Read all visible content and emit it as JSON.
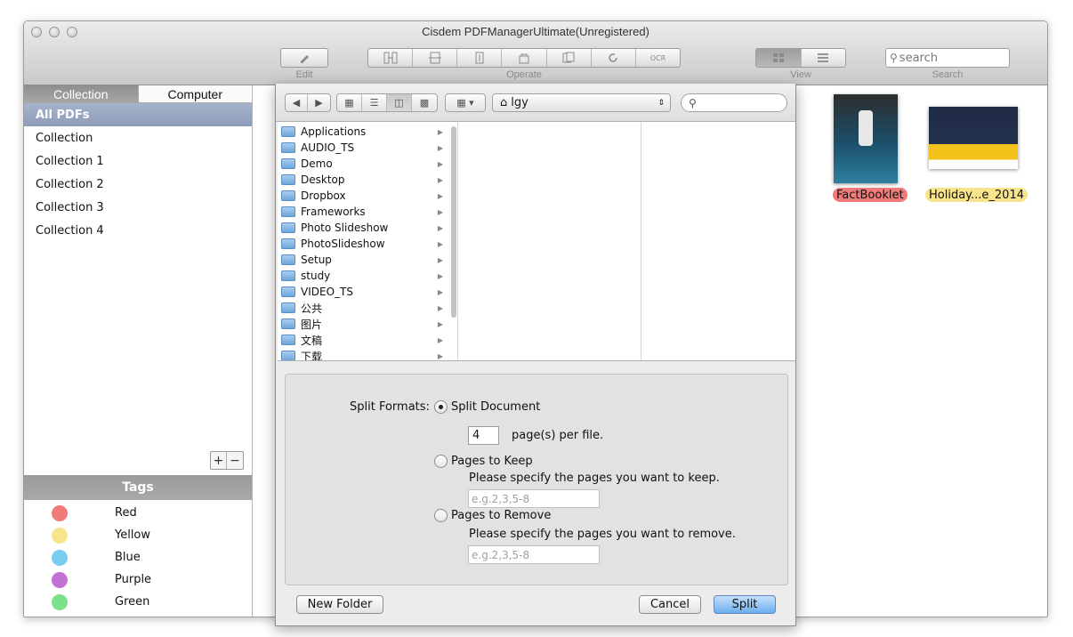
{
  "window": {
    "title": "Cisdem PDFManagerUltimate(Unregistered)"
  },
  "toolbar": {
    "edit_label": "Edit",
    "operate_label": "Operate",
    "view_label": "View",
    "search_label": "Search",
    "search_placeholder": "search",
    "ocr_label": "OCR"
  },
  "sidebar": {
    "tabs": [
      {
        "label": "Collection",
        "active": true
      },
      {
        "label": "Computer",
        "active": false
      }
    ],
    "items": [
      {
        "label": "All PDFs"
      },
      {
        "label": "Collection"
      },
      {
        "label": "Collection 1"
      },
      {
        "label": "Collection 2"
      },
      {
        "label": "Collection 3"
      },
      {
        "label": "Collection 4"
      }
    ],
    "add_label": "+",
    "remove_label": "−"
  },
  "tags": {
    "header": "Tags",
    "items": [
      {
        "label": "Red",
        "color": "#f07b78"
      },
      {
        "label": "Yellow",
        "color": "#f8e48c"
      },
      {
        "label": "Blue",
        "color": "#78cdf0"
      },
      {
        "label": "Purple",
        "color": "#c471d6"
      },
      {
        "label": "Green",
        "color": "#7de08a"
      }
    ]
  },
  "documents": [
    {
      "name": "FactBooklet",
      "tag_color": "#f07b78"
    },
    {
      "name": "Holiday...e_2014",
      "tag_color": "#f8e48c"
    }
  ],
  "dialog": {
    "location": "lgy",
    "files": [
      {
        "name": "Applications",
        "icon": "applications-folder-icon"
      },
      {
        "name": "AUDIO_TS",
        "icon": "folder-icon"
      },
      {
        "name": "Demo",
        "icon": "folder-icon"
      },
      {
        "name": "Desktop",
        "icon": "desktop-folder-icon"
      },
      {
        "name": "Dropbox",
        "icon": "dropbox-folder-icon"
      },
      {
        "name": "Frameworks",
        "icon": "folder-icon"
      },
      {
        "name": "Photo Slideshow",
        "icon": "folder-icon"
      },
      {
        "name": "PhotoSlideshow",
        "icon": "folder-icon"
      },
      {
        "name": "Setup",
        "icon": "folder-icon"
      },
      {
        "name": "study",
        "icon": "folder-icon"
      },
      {
        "name": "VIDEO_TS",
        "icon": "folder-icon"
      },
      {
        "name": "公共",
        "icon": "public-folder-icon"
      },
      {
        "name": "图片",
        "icon": "pictures-folder-icon"
      },
      {
        "name": "文稿",
        "icon": "documents-folder-icon"
      },
      {
        "name": "下载",
        "icon": "downloads-folder-icon"
      }
    ],
    "split_formats_label": "Split Formats:",
    "split_document_label": "Split Document",
    "pages_per_file_value": "4",
    "pages_per_file_label": "page(s) per file.",
    "pages_to_keep_label": "Pages to Keep",
    "keep_hint": "Please specify the pages you want to keep.",
    "keep_placeholder": "e.g.2,3,5-8",
    "pages_to_remove_label": "Pages to Remove",
    "remove_hint": "Please specify the pages you want to remove.",
    "remove_placeholder": "e.g.2,3,5-8",
    "selected_option": "Split Document",
    "new_folder_label": "New Folder",
    "cancel_label": "Cancel",
    "split_label": "Split"
  }
}
